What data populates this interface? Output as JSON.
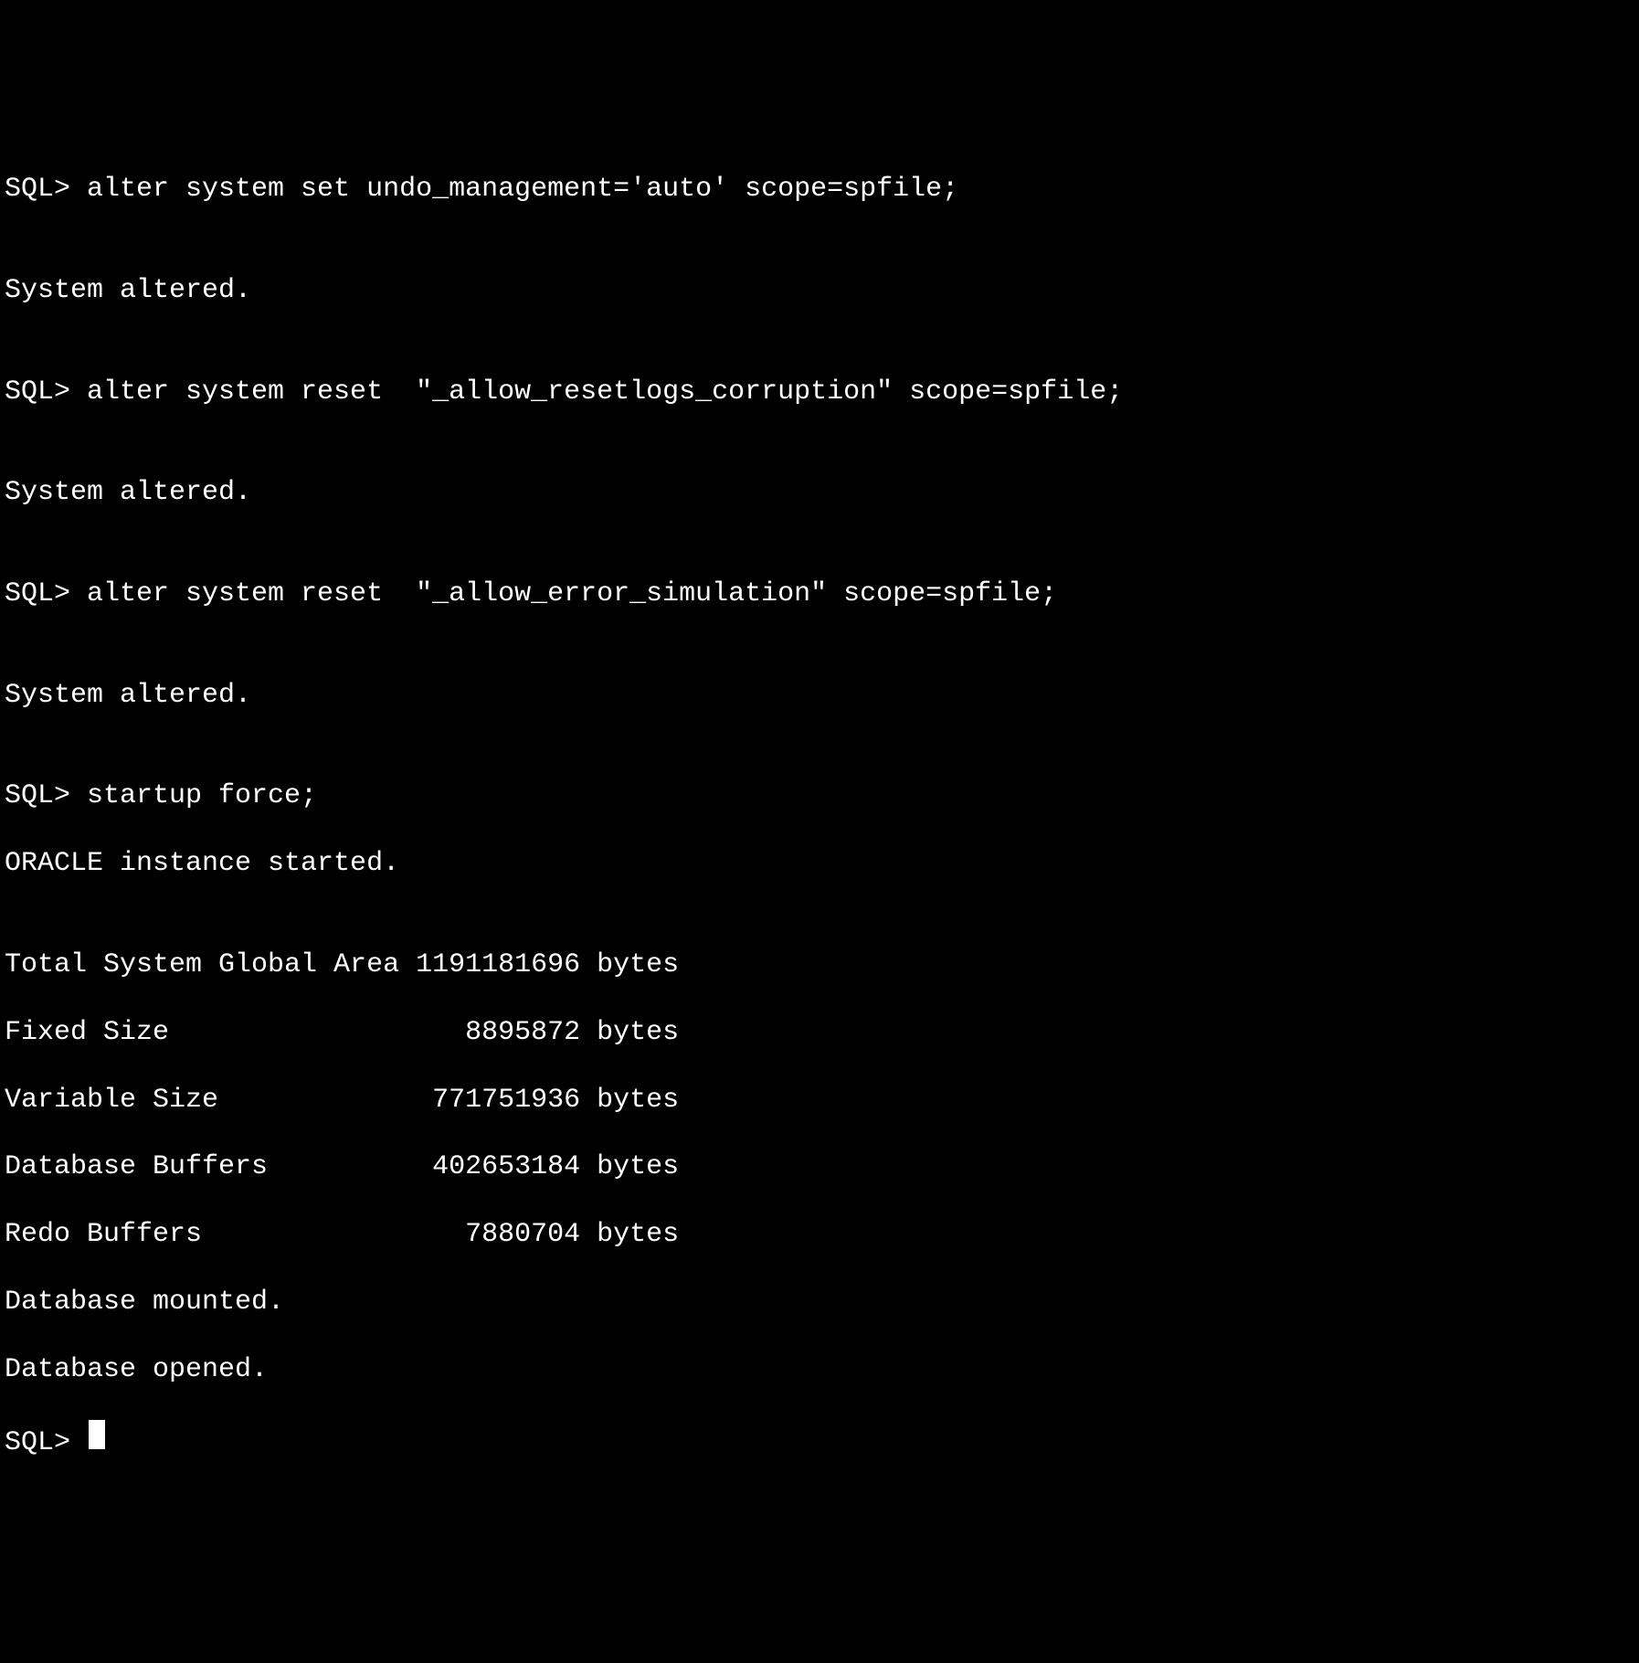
{
  "terminal": {
    "lines": [
      "SQL> alter system set undo_management='auto' scope=spfile;",
      "",
      "System altered.",
      "",
      "SQL> alter system reset  \"_allow_resetlogs_corruption\" scope=spfile;",
      "",
      "System altered.",
      "",
      "SQL> alter system reset  \"_allow_error_simulation\" scope=spfile;",
      "",
      "System altered.",
      "",
      "SQL> startup force;",
      "ORACLE instance started.",
      "",
      "Total System Global Area 1191181696 bytes",
      "Fixed Size                  8895872 bytes",
      "Variable Size             771751936 bytes",
      "Database Buffers          402653184 bytes",
      "Redo Buffers                7880704 bytes",
      "Database mounted.",
      "Database opened."
    ],
    "prompt": "SQL> "
  }
}
